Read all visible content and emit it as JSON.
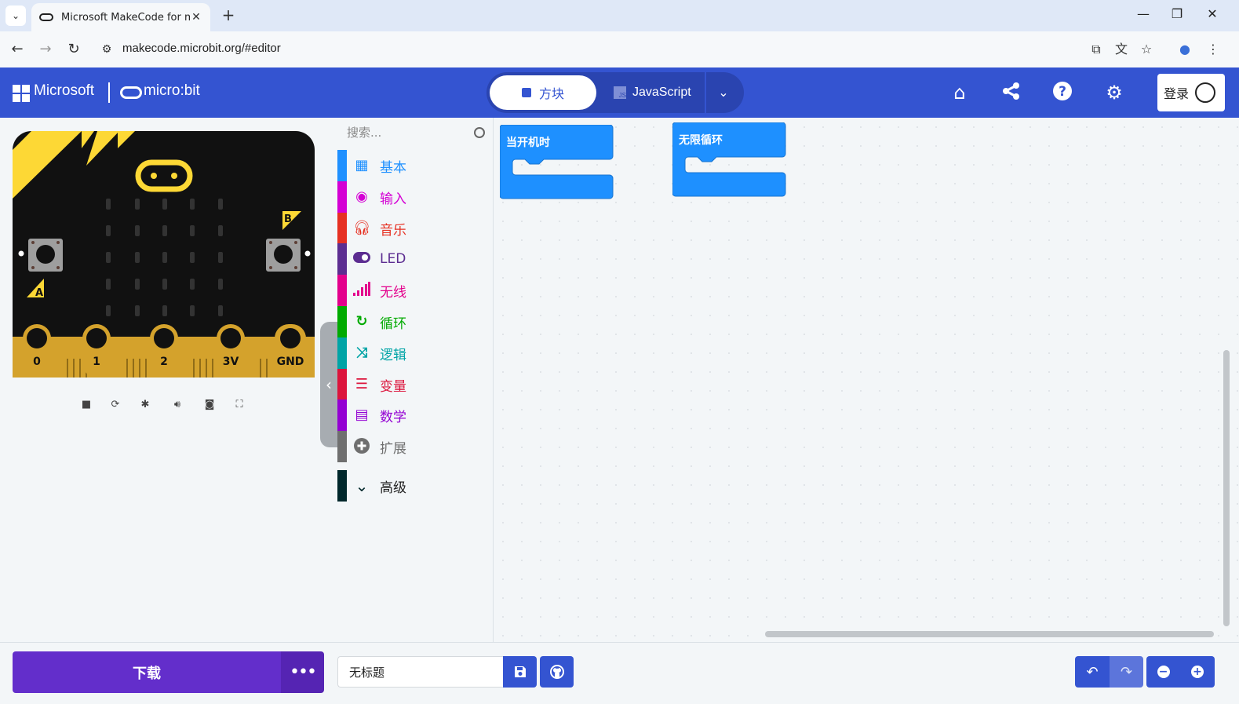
{
  "browser": {
    "tab_title": "Microsoft MakeCode for mic",
    "url": "makecode.microbit.org/#editor"
  },
  "header": {
    "ms_brand": "Microsoft",
    "mb_brand": "micro:bit",
    "blocks_label": "方块",
    "js_label": "JavaScript",
    "js_badge": "JS",
    "login_label": "登录",
    "accent": "#3454d1"
  },
  "simulator": {
    "pins": [
      "0",
      "1",
      "2",
      "3V",
      "GND"
    ],
    "button_a": "A",
    "button_b": "B",
    "controls": [
      "stop-icon",
      "restart-icon",
      "debug-icon",
      "sound-icon",
      "screenshot-icon",
      "fullscreen-icon"
    ]
  },
  "toolbox": {
    "search_placeholder": "搜索...",
    "categories": [
      {
        "label": "基本",
        "color": "#1e90ff",
        "icon": "grid-icon"
      },
      {
        "label": "输入",
        "color": "#d400d4",
        "icon": "circle-dot-icon"
      },
      {
        "label": "音乐",
        "color": "#e63022",
        "icon": "headphones-icon"
      },
      {
        "label": "LED",
        "color": "#5c2d91",
        "icon": "toggle-icon"
      },
      {
        "label": "无线",
        "color": "#e3008c",
        "icon": "signal-icon"
      },
      {
        "label": "循环",
        "color": "#00aa00",
        "icon": "refresh-icon"
      },
      {
        "label": "逻辑",
        "color": "#00a4a6",
        "icon": "shuffle-icon"
      },
      {
        "label": "变量",
        "color": "#dc143c",
        "icon": "list-icon"
      },
      {
        "label": "数学",
        "color": "#9400d3",
        "icon": "calculator-icon"
      },
      {
        "label": "扩展",
        "color": "#6f6f6f",
        "icon": "plus-circle-icon"
      }
    ],
    "advanced_label": "高级",
    "advanced_color": "#00272b"
  },
  "workspace": {
    "blocks": [
      {
        "label": "当开机时",
        "color": "#1e90ff"
      },
      {
        "label": "无限循环",
        "color": "#1e90ff"
      }
    ]
  },
  "footer": {
    "download_label": "下载",
    "project_name": "无标题"
  }
}
